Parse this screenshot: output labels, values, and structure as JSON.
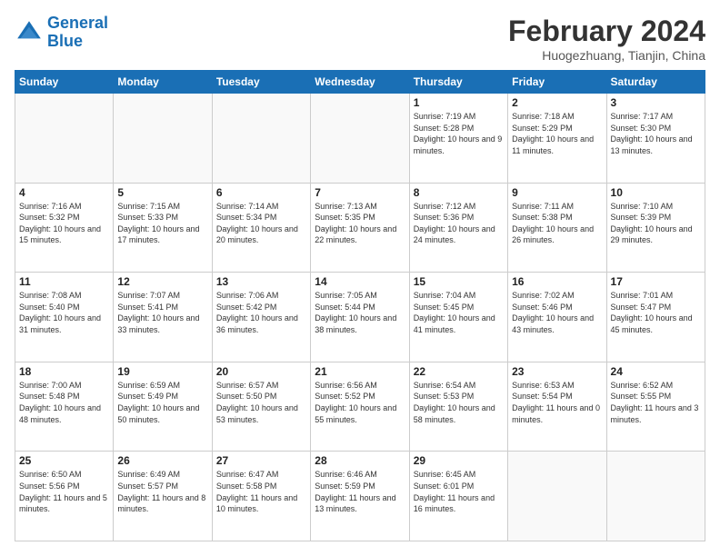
{
  "logo": {
    "line1": "General",
    "line2": "Blue"
  },
  "title": "February 2024",
  "location": "Huogezhuang, Tianjin, China",
  "days_of_week": [
    "Sunday",
    "Monday",
    "Tuesday",
    "Wednesday",
    "Thursday",
    "Friday",
    "Saturday"
  ],
  "weeks": [
    [
      {
        "day": "",
        "info": ""
      },
      {
        "day": "",
        "info": ""
      },
      {
        "day": "",
        "info": ""
      },
      {
        "day": "",
        "info": ""
      },
      {
        "day": "1",
        "info": "Sunrise: 7:19 AM\nSunset: 5:28 PM\nDaylight: 10 hours\nand 9 minutes."
      },
      {
        "day": "2",
        "info": "Sunrise: 7:18 AM\nSunset: 5:29 PM\nDaylight: 10 hours\nand 11 minutes."
      },
      {
        "day": "3",
        "info": "Sunrise: 7:17 AM\nSunset: 5:30 PM\nDaylight: 10 hours\nand 13 minutes."
      }
    ],
    [
      {
        "day": "4",
        "info": "Sunrise: 7:16 AM\nSunset: 5:32 PM\nDaylight: 10 hours\nand 15 minutes."
      },
      {
        "day": "5",
        "info": "Sunrise: 7:15 AM\nSunset: 5:33 PM\nDaylight: 10 hours\nand 17 minutes."
      },
      {
        "day": "6",
        "info": "Sunrise: 7:14 AM\nSunset: 5:34 PM\nDaylight: 10 hours\nand 20 minutes."
      },
      {
        "day": "7",
        "info": "Sunrise: 7:13 AM\nSunset: 5:35 PM\nDaylight: 10 hours\nand 22 minutes."
      },
      {
        "day": "8",
        "info": "Sunrise: 7:12 AM\nSunset: 5:36 PM\nDaylight: 10 hours\nand 24 minutes."
      },
      {
        "day": "9",
        "info": "Sunrise: 7:11 AM\nSunset: 5:38 PM\nDaylight: 10 hours\nand 26 minutes."
      },
      {
        "day": "10",
        "info": "Sunrise: 7:10 AM\nSunset: 5:39 PM\nDaylight: 10 hours\nand 29 minutes."
      }
    ],
    [
      {
        "day": "11",
        "info": "Sunrise: 7:08 AM\nSunset: 5:40 PM\nDaylight: 10 hours\nand 31 minutes."
      },
      {
        "day": "12",
        "info": "Sunrise: 7:07 AM\nSunset: 5:41 PM\nDaylight: 10 hours\nand 33 minutes."
      },
      {
        "day": "13",
        "info": "Sunrise: 7:06 AM\nSunset: 5:42 PM\nDaylight: 10 hours\nand 36 minutes."
      },
      {
        "day": "14",
        "info": "Sunrise: 7:05 AM\nSunset: 5:44 PM\nDaylight: 10 hours\nand 38 minutes."
      },
      {
        "day": "15",
        "info": "Sunrise: 7:04 AM\nSunset: 5:45 PM\nDaylight: 10 hours\nand 41 minutes."
      },
      {
        "day": "16",
        "info": "Sunrise: 7:02 AM\nSunset: 5:46 PM\nDaylight: 10 hours\nand 43 minutes."
      },
      {
        "day": "17",
        "info": "Sunrise: 7:01 AM\nSunset: 5:47 PM\nDaylight: 10 hours\nand 45 minutes."
      }
    ],
    [
      {
        "day": "18",
        "info": "Sunrise: 7:00 AM\nSunset: 5:48 PM\nDaylight: 10 hours\nand 48 minutes."
      },
      {
        "day": "19",
        "info": "Sunrise: 6:59 AM\nSunset: 5:49 PM\nDaylight: 10 hours\nand 50 minutes."
      },
      {
        "day": "20",
        "info": "Sunrise: 6:57 AM\nSunset: 5:50 PM\nDaylight: 10 hours\nand 53 minutes."
      },
      {
        "day": "21",
        "info": "Sunrise: 6:56 AM\nSunset: 5:52 PM\nDaylight: 10 hours\nand 55 minutes."
      },
      {
        "day": "22",
        "info": "Sunrise: 6:54 AM\nSunset: 5:53 PM\nDaylight: 10 hours\nand 58 minutes."
      },
      {
        "day": "23",
        "info": "Sunrise: 6:53 AM\nSunset: 5:54 PM\nDaylight: 11 hours\nand 0 minutes."
      },
      {
        "day": "24",
        "info": "Sunrise: 6:52 AM\nSunset: 5:55 PM\nDaylight: 11 hours\nand 3 minutes."
      }
    ],
    [
      {
        "day": "25",
        "info": "Sunrise: 6:50 AM\nSunset: 5:56 PM\nDaylight: 11 hours\nand 5 minutes."
      },
      {
        "day": "26",
        "info": "Sunrise: 6:49 AM\nSunset: 5:57 PM\nDaylight: 11 hours\nand 8 minutes."
      },
      {
        "day": "27",
        "info": "Sunrise: 6:47 AM\nSunset: 5:58 PM\nDaylight: 11 hours\nand 10 minutes."
      },
      {
        "day": "28",
        "info": "Sunrise: 6:46 AM\nSunset: 5:59 PM\nDaylight: 11 hours\nand 13 minutes."
      },
      {
        "day": "29",
        "info": "Sunrise: 6:45 AM\nSunset: 6:01 PM\nDaylight: 11 hours\nand 16 minutes."
      },
      {
        "day": "",
        "info": ""
      },
      {
        "day": "",
        "info": ""
      }
    ]
  ]
}
